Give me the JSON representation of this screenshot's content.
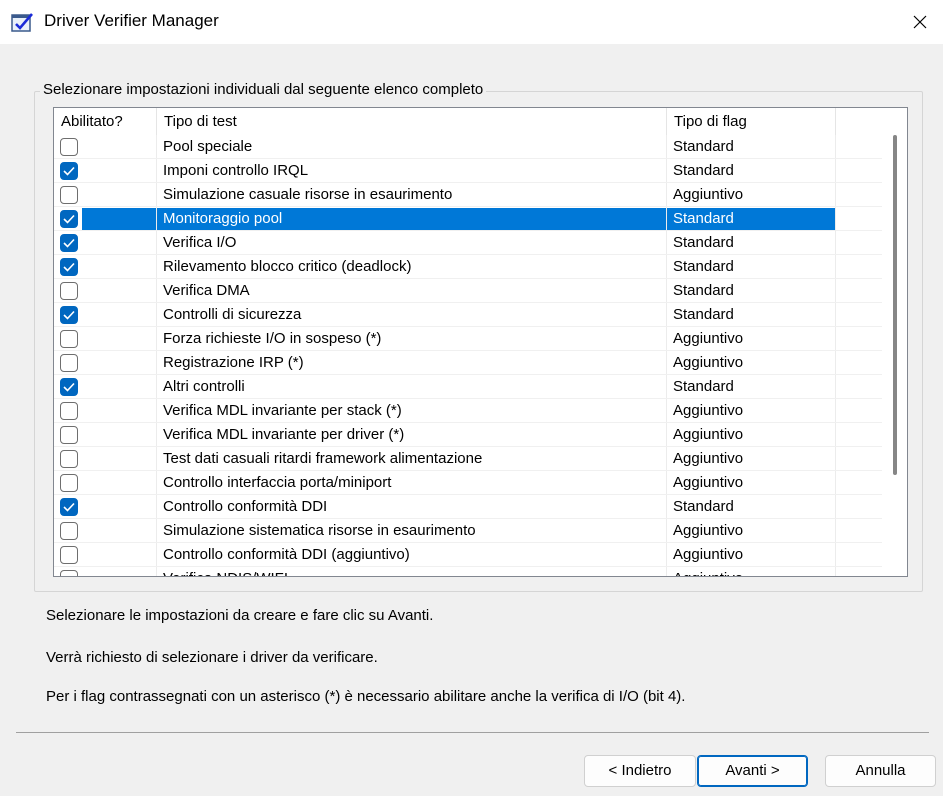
{
  "window": {
    "title": "Driver Verifier Manager"
  },
  "group": {
    "legend": "Selezionare impostazioni individuali dal seguente elenco completo"
  },
  "list": {
    "headers": [
      "Abilitato?",
      "Tipo di test",
      "Tipo di flag"
    ],
    "rows": [
      {
        "checked": false,
        "test": "Pool speciale",
        "flag": "Standard"
      },
      {
        "checked": true,
        "test": "Imponi controllo IRQL",
        "flag": "Standard"
      },
      {
        "checked": false,
        "test": "Simulazione casuale risorse in esaurimento",
        "flag": "Aggiuntivo"
      },
      {
        "checked": true,
        "test": "Monitoraggio pool",
        "flag": "Standard",
        "selected": true
      },
      {
        "checked": true,
        "test": "Verifica I/O",
        "flag": "Standard"
      },
      {
        "checked": true,
        "test": "Rilevamento blocco critico (deadlock)",
        "flag": "Standard"
      },
      {
        "checked": false,
        "test": "Verifica DMA",
        "flag": "Standard"
      },
      {
        "checked": true,
        "test": "Controlli di sicurezza",
        "flag": "Standard"
      },
      {
        "checked": false,
        "test": "Forza richieste I/O in sospeso (*)",
        "flag": "Aggiuntivo"
      },
      {
        "checked": false,
        "test": "Registrazione IRP (*)",
        "flag": "Aggiuntivo"
      },
      {
        "checked": true,
        "test": "Altri controlli",
        "flag": "Standard"
      },
      {
        "checked": false,
        "test": "Verifica MDL invariante per stack (*)",
        "flag": "Aggiuntivo"
      },
      {
        "checked": false,
        "test": "Verifica MDL invariante per driver (*)",
        "flag": "Aggiuntivo"
      },
      {
        "checked": false,
        "test": "Test dati casuali ritardi framework alimentazione",
        "flag": "Aggiuntivo"
      },
      {
        "checked": false,
        "test": "Controllo interfaccia porta/miniport",
        "flag": "Aggiuntivo"
      },
      {
        "checked": true,
        "test": "Controllo conformità DDI",
        "flag": "Standard"
      },
      {
        "checked": false,
        "test": "Simulazione sistematica risorse in esaurimento",
        "flag": "Aggiuntivo"
      },
      {
        "checked": false,
        "test": "Controllo conformità DDI (aggiuntivo)",
        "flag": "Aggiuntivo"
      },
      {
        "checked": false,
        "test": "Verifica NDIS/WIFI",
        "flag": "Aggiuntivo"
      }
    ]
  },
  "info": {
    "line1": "Selezionare le impostazioni da creare e fare clic su Avanti.",
    "line2": "Verrà richiesto di selezionare i driver da verificare.",
    "line3": "Per i flag contrassegnati con un asterisco (*) è necessario abilitare anche la verifica di I/O (bit 4)."
  },
  "buttons": {
    "back": "< Indietro",
    "next": "Avanti >",
    "cancel": "Annulla"
  },
  "colors": {
    "selection": "#0078d7",
    "checkbox": "#0067c0"
  }
}
